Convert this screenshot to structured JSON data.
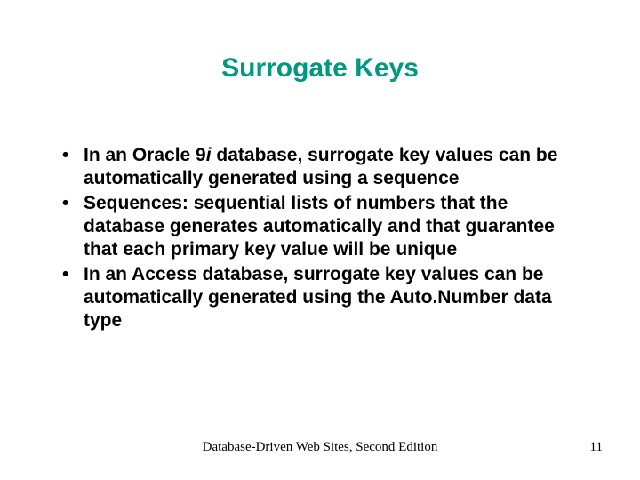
{
  "title": "Surrogate Keys",
  "bullets": [
    {
      "pre": "In an Oracle 9",
      "italic": "i",
      "post": " database, surrogate key values can be automatically generated using a sequence"
    },
    {
      "pre": "Sequences: sequential lists of numbers that the database generates automatically and that guarantee that each primary key value will be unique",
      "italic": "",
      "post": ""
    },
    {
      "pre": "In an Access database, surrogate key values can be automatically generated using the Auto.Number data type",
      "italic": "",
      "post": ""
    }
  ],
  "footer": "Database-Driven Web Sites, Second Edition",
  "page_number": "11"
}
